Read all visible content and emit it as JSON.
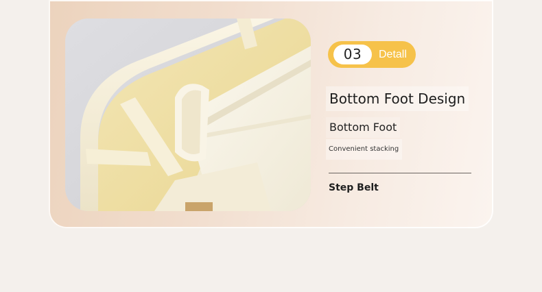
{
  "feature": {
    "number": "03",
    "detail_label": "Detall",
    "title": "Bottom Foot Design",
    "subtitle": "Bottom Foot",
    "description": "Convenient stacking",
    "secondary_title": "Step Belt"
  },
  "product_image": {
    "subject": "cream-colored plastic organizer box corner with compartments"
  },
  "colors": {
    "badge_accent": "#f6c24a",
    "card_gradient_start": "#ecd3bd",
    "card_gradient_end": "#fbf4ef",
    "page_background": "#f4f0ec"
  }
}
